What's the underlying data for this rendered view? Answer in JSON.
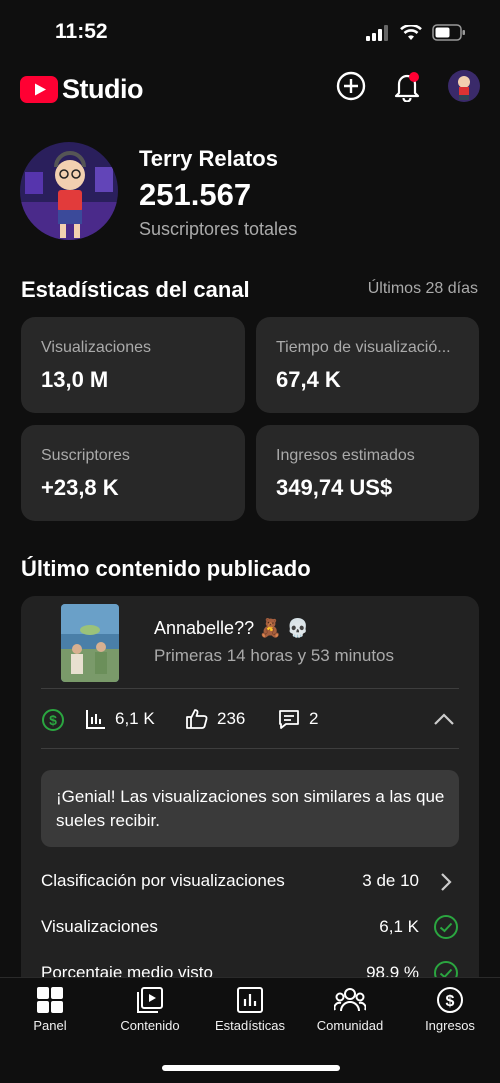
{
  "status_bar": {
    "time": "11:52"
  },
  "header": {
    "logo_text": "Studio",
    "icons": [
      "create-icon",
      "notifications-icon",
      "account-avatar"
    ]
  },
  "channel": {
    "name": "Terry Relatos",
    "subscribers": "251.567",
    "subscribers_label": "Suscriptores totales"
  },
  "stats": {
    "title": "Estadísticas del canal",
    "range": "Últimos 28 días",
    "cards": [
      {
        "label": "Visualizaciones",
        "value": "13,0 M"
      },
      {
        "label": "Tiempo de visualizació...",
        "value": "67,4 K"
      },
      {
        "label": "Suscriptores",
        "value": "+23,8 K"
      },
      {
        "label": "Ingresos estimados",
        "value": "349,74 US$"
      }
    ]
  },
  "latest": {
    "title": "Último contenido publicado",
    "video_title": "Annabelle?? 🧸 💀",
    "video_subtitle": "Primeras 14 horas y 53 minutos",
    "views": "6,1 K",
    "likes": "236",
    "comments": "2",
    "notice": "¡Genial! Las visualizaciones son similares a las que sueles recibir.",
    "rows": [
      {
        "label": "Clasificación por visualizaciones",
        "value": "3 de 10"
      },
      {
        "label": "Visualizaciones",
        "value": "6,1 K"
      },
      {
        "label": "Porcentaje medio visto",
        "value": "98,9 %"
      }
    ]
  },
  "nav": [
    {
      "label": "Panel",
      "icon": "dashboard-icon"
    },
    {
      "label": "Contenido",
      "icon": "content-icon"
    },
    {
      "label": "Estadísticas",
      "icon": "analytics-icon"
    },
    {
      "label": "Comunidad",
      "icon": "community-icon"
    },
    {
      "label": "Ingresos",
      "icon": "earn-icon"
    }
  ],
  "colors": {
    "accent_red": "#ff0033",
    "success_green": "#2ba640",
    "background": "#0f0f0f",
    "card": "#282828"
  }
}
